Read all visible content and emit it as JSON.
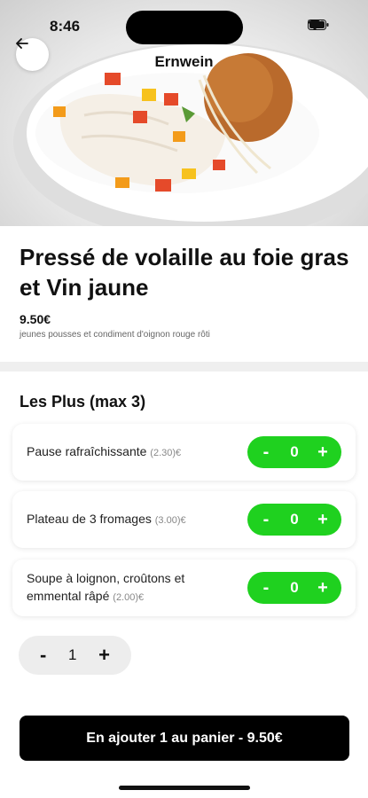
{
  "status_bar": {
    "time": "8:46"
  },
  "header": {
    "title": "Ernwein",
    "back_icon": "arrow-left-icon"
  },
  "product": {
    "name": "Pressé de volaille au foie gras et Vin jaune",
    "price": "9.50€",
    "description": "jeunes pousses et condiment d'oignon rouge rôti"
  },
  "extras": {
    "title": "Les Plus (max 3)",
    "items": [
      {
        "label": "Pause rafraîchissante",
        "price": "(2.30)€",
        "quantity": "0"
      },
      {
        "label": "Plateau de 3 fromages",
        "price": "(3.00)€",
        "quantity": "0"
      },
      {
        "label": "Soupe à loignon, croûtons et emmental râpé",
        "price": "(2.00)€",
        "quantity": "0"
      }
    ],
    "minus": "-",
    "plus": "+"
  },
  "quantity": {
    "value": "1",
    "minus": "-",
    "plus": "+"
  },
  "cta": {
    "label": "En ajouter 1 au panier - 9.50€"
  },
  "colors": {
    "accent": "#1fd11f",
    "cta_bg": "#000000",
    "qty_bg": "#ededed"
  }
}
